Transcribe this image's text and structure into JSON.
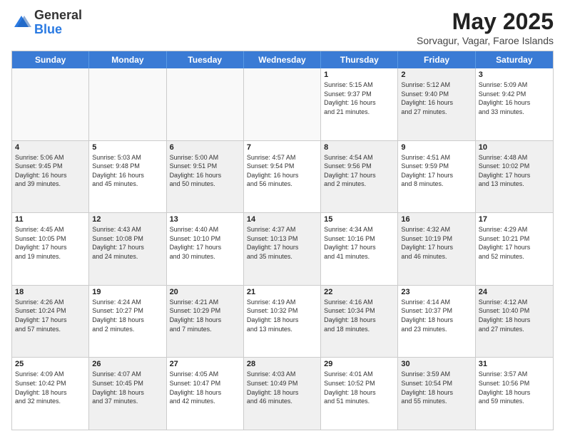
{
  "header": {
    "logo": {
      "general": "General",
      "blue": "Blue"
    },
    "title": "May 2025",
    "location": "Sorvagur, Vagar, Faroe Islands"
  },
  "weekdays": [
    "Sunday",
    "Monday",
    "Tuesday",
    "Wednesday",
    "Thursday",
    "Friday",
    "Saturday"
  ],
  "rows": [
    [
      {
        "day": "",
        "info": "",
        "shaded": false,
        "empty": true
      },
      {
        "day": "",
        "info": "",
        "shaded": false,
        "empty": true
      },
      {
        "day": "",
        "info": "",
        "shaded": false,
        "empty": true
      },
      {
        "day": "",
        "info": "",
        "shaded": false,
        "empty": true
      },
      {
        "day": "1",
        "info": "Sunrise: 5:15 AM\nSunset: 9:37 PM\nDaylight: 16 hours\nand 21 minutes.",
        "shaded": false,
        "empty": false
      },
      {
        "day": "2",
        "info": "Sunrise: 5:12 AM\nSunset: 9:40 PM\nDaylight: 16 hours\nand 27 minutes.",
        "shaded": true,
        "empty": false
      },
      {
        "day": "3",
        "info": "Sunrise: 5:09 AM\nSunset: 9:42 PM\nDaylight: 16 hours\nand 33 minutes.",
        "shaded": false,
        "empty": false
      }
    ],
    [
      {
        "day": "4",
        "info": "Sunrise: 5:06 AM\nSunset: 9:45 PM\nDaylight: 16 hours\nand 39 minutes.",
        "shaded": true,
        "empty": false
      },
      {
        "day": "5",
        "info": "Sunrise: 5:03 AM\nSunset: 9:48 PM\nDaylight: 16 hours\nand 45 minutes.",
        "shaded": false,
        "empty": false
      },
      {
        "day": "6",
        "info": "Sunrise: 5:00 AM\nSunset: 9:51 PM\nDaylight: 16 hours\nand 50 minutes.",
        "shaded": true,
        "empty": false
      },
      {
        "day": "7",
        "info": "Sunrise: 4:57 AM\nSunset: 9:54 PM\nDaylight: 16 hours\nand 56 minutes.",
        "shaded": false,
        "empty": false
      },
      {
        "day": "8",
        "info": "Sunrise: 4:54 AM\nSunset: 9:56 PM\nDaylight: 17 hours\nand 2 minutes.",
        "shaded": true,
        "empty": false
      },
      {
        "day": "9",
        "info": "Sunrise: 4:51 AM\nSunset: 9:59 PM\nDaylight: 17 hours\nand 8 minutes.",
        "shaded": false,
        "empty": false
      },
      {
        "day": "10",
        "info": "Sunrise: 4:48 AM\nSunset: 10:02 PM\nDaylight: 17 hours\nand 13 minutes.",
        "shaded": true,
        "empty": false
      }
    ],
    [
      {
        "day": "11",
        "info": "Sunrise: 4:45 AM\nSunset: 10:05 PM\nDaylight: 17 hours\nand 19 minutes.",
        "shaded": false,
        "empty": false
      },
      {
        "day": "12",
        "info": "Sunrise: 4:43 AM\nSunset: 10:08 PM\nDaylight: 17 hours\nand 24 minutes.",
        "shaded": true,
        "empty": false
      },
      {
        "day": "13",
        "info": "Sunrise: 4:40 AM\nSunset: 10:10 PM\nDaylight: 17 hours\nand 30 minutes.",
        "shaded": false,
        "empty": false
      },
      {
        "day": "14",
        "info": "Sunrise: 4:37 AM\nSunset: 10:13 PM\nDaylight: 17 hours\nand 35 minutes.",
        "shaded": true,
        "empty": false
      },
      {
        "day": "15",
        "info": "Sunrise: 4:34 AM\nSunset: 10:16 PM\nDaylight: 17 hours\nand 41 minutes.",
        "shaded": false,
        "empty": false
      },
      {
        "day": "16",
        "info": "Sunrise: 4:32 AM\nSunset: 10:19 PM\nDaylight: 17 hours\nand 46 minutes.",
        "shaded": true,
        "empty": false
      },
      {
        "day": "17",
        "info": "Sunrise: 4:29 AM\nSunset: 10:21 PM\nDaylight: 17 hours\nand 52 minutes.",
        "shaded": false,
        "empty": false
      }
    ],
    [
      {
        "day": "18",
        "info": "Sunrise: 4:26 AM\nSunset: 10:24 PM\nDaylight: 17 hours\nand 57 minutes.",
        "shaded": true,
        "empty": false
      },
      {
        "day": "19",
        "info": "Sunrise: 4:24 AM\nSunset: 10:27 PM\nDaylight: 18 hours\nand 2 minutes.",
        "shaded": false,
        "empty": false
      },
      {
        "day": "20",
        "info": "Sunrise: 4:21 AM\nSunset: 10:29 PM\nDaylight: 18 hours\nand 7 minutes.",
        "shaded": true,
        "empty": false
      },
      {
        "day": "21",
        "info": "Sunrise: 4:19 AM\nSunset: 10:32 PM\nDaylight: 18 hours\nand 13 minutes.",
        "shaded": false,
        "empty": false
      },
      {
        "day": "22",
        "info": "Sunrise: 4:16 AM\nSunset: 10:34 PM\nDaylight: 18 hours\nand 18 minutes.",
        "shaded": true,
        "empty": false
      },
      {
        "day": "23",
        "info": "Sunrise: 4:14 AM\nSunset: 10:37 PM\nDaylight: 18 hours\nand 23 minutes.",
        "shaded": false,
        "empty": false
      },
      {
        "day": "24",
        "info": "Sunrise: 4:12 AM\nSunset: 10:40 PM\nDaylight: 18 hours\nand 27 minutes.",
        "shaded": true,
        "empty": false
      }
    ],
    [
      {
        "day": "25",
        "info": "Sunrise: 4:09 AM\nSunset: 10:42 PM\nDaylight: 18 hours\nand 32 minutes.",
        "shaded": false,
        "empty": false
      },
      {
        "day": "26",
        "info": "Sunrise: 4:07 AM\nSunset: 10:45 PM\nDaylight: 18 hours\nand 37 minutes.",
        "shaded": true,
        "empty": false
      },
      {
        "day": "27",
        "info": "Sunrise: 4:05 AM\nSunset: 10:47 PM\nDaylight: 18 hours\nand 42 minutes.",
        "shaded": false,
        "empty": false
      },
      {
        "day": "28",
        "info": "Sunrise: 4:03 AM\nSunset: 10:49 PM\nDaylight: 18 hours\nand 46 minutes.",
        "shaded": true,
        "empty": false
      },
      {
        "day": "29",
        "info": "Sunrise: 4:01 AM\nSunset: 10:52 PM\nDaylight: 18 hours\nand 51 minutes.",
        "shaded": false,
        "empty": false
      },
      {
        "day": "30",
        "info": "Sunrise: 3:59 AM\nSunset: 10:54 PM\nDaylight: 18 hours\nand 55 minutes.",
        "shaded": true,
        "empty": false
      },
      {
        "day": "31",
        "info": "Sunrise: 3:57 AM\nSunset: 10:56 PM\nDaylight: 18 hours\nand 59 minutes.",
        "shaded": false,
        "empty": false
      }
    ]
  ]
}
